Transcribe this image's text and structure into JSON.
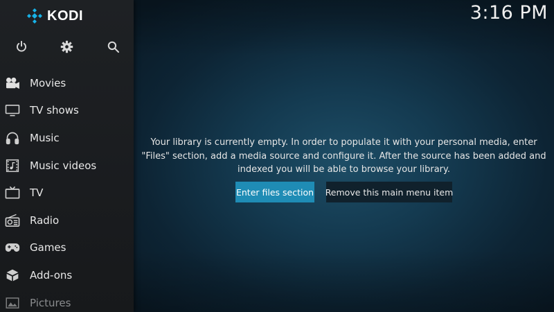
{
  "app": {
    "name": "KODI"
  },
  "clock": {
    "time": "3:16 PM"
  },
  "top_icons": [
    {
      "name": "power-icon"
    },
    {
      "name": "gear-icon"
    },
    {
      "name": "search-icon"
    }
  ],
  "menu": {
    "items": [
      {
        "label": "Movies",
        "icon": "movie-camera-icon"
      },
      {
        "label": "TV shows",
        "icon": "tv-icon"
      },
      {
        "label": "Music",
        "icon": "headphones-icon"
      },
      {
        "label": "Music videos",
        "icon": "music-video-icon"
      },
      {
        "label": "TV",
        "icon": "live-tv-icon"
      },
      {
        "label": "Radio",
        "icon": "radio-icon"
      },
      {
        "label": "Games",
        "icon": "gamepad-icon"
      },
      {
        "label": "Add-ons",
        "icon": "addons-box-icon"
      },
      {
        "label": "Pictures",
        "icon": "picture-icon"
      }
    ]
  },
  "main": {
    "message_line1": "Your library is currently empty. In order to populate it with your personal media, enter",
    "message_line2": "\"Files\" section, add a media source and configure it. After the source has been added and",
    "message_line3": "indexed you will be able to browse your library.",
    "primary_button": "Enter files section",
    "secondary_button": "Remove this main menu item"
  },
  "colors": {
    "accent": "#1f8cb5",
    "logo_blue": "#17b2e7"
  }
}
